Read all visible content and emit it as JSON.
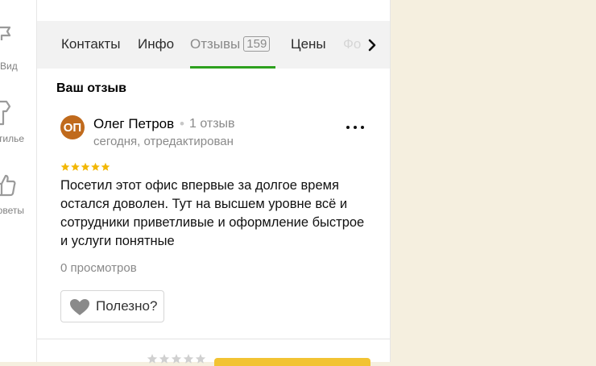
{
  "rail": {
    "items": [
      {
        "label": "Вид",
        "icon": "flag-icon"
      },
      {
        "label": "Стилье",
        "icon": "hairdryer-icon"
      },
      {
        "label": "Советы",
        "icon": "thumbs-up-icon"
      }
    ]
  },
  "tabs": {
    "items": [
      {
        "label": "Контакты"
      },
      {
        "label": "Инфо"
      },
      {
        "label": "Отзывы",
        "count": "159",
        "active": true
      },
      {
        "label": "Цены"
      },
      {
        "label": "Фо"
      }
    ],
    "active_color": "#2da01e"
  },
  "review": {
    "section_title": "Ваш отзыв",
    "avatar_initials": "ОП",
    "avatar_color": "#c06a1c",
    "author": "Олег Петров",
    "separator": "•",
    "author_reviews": "1 отзыв",
    "date": "сегодня, отредактирован",
    "rating": 5,
    "rating_max": 5,
    "star_color": "#f2b705",
    "text": "Посетил этот офис впервые за долгое время остался доволен. Тут на высшем уровне всё и сотрудники приветливые и оформление быстрое и услуги понятные",
    "views": "0 просмотров",
    "helpful_label": "Полезно?"
  },
  "bottom": {
    "rate_stars": 5,
    "button_color": "#f2c333"
  }
}
